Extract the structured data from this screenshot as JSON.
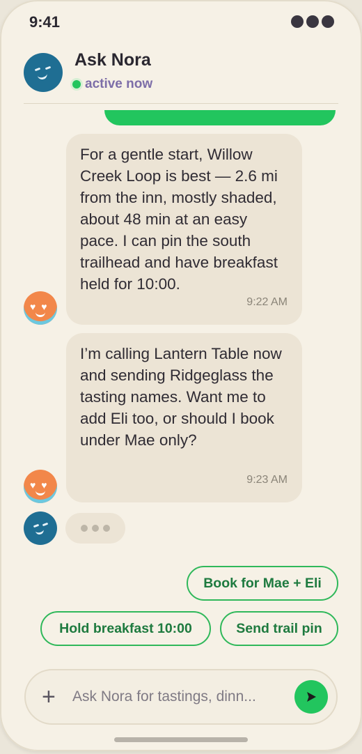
{
  "status_bar": {
    "time": "9:41"
  },
  "header": {
    "title": "Ask Nora",
    "status": "active now"
  },
  "messages": [
    {
      "text": "For a gentle start, Willow Creek Loop is best — 2.6 mi from the inn, mostly shaded, about 48 min at an easy pace. I can pin the south trailhead and have breakfast held for 10:00.",
      "time": "9:22 AM"
    },
    {
      "text": "I’m calling Lantern Table now and sending Ridgeglass the tasting names. Want me to add Eli too, or should I book under Mae only?",
      "time": "9:23 AM"
    }
  ],
  "quick_replies": [
    "Book for Mae + Eli",
    "Hold breakfast 10:00",
    "Send trail pin"
  ],
  "composer": {
    "placeholder": "Ask Nora for tastings, dinn...",
    "plus": "+"
  },
  "colors": {
    "accent": "#22c55e",
    "nora_avatar": "#1f6e93",
    "user_avatar": "#f2874a",
    "chip_text": "#1e7a3f"
  }
}
